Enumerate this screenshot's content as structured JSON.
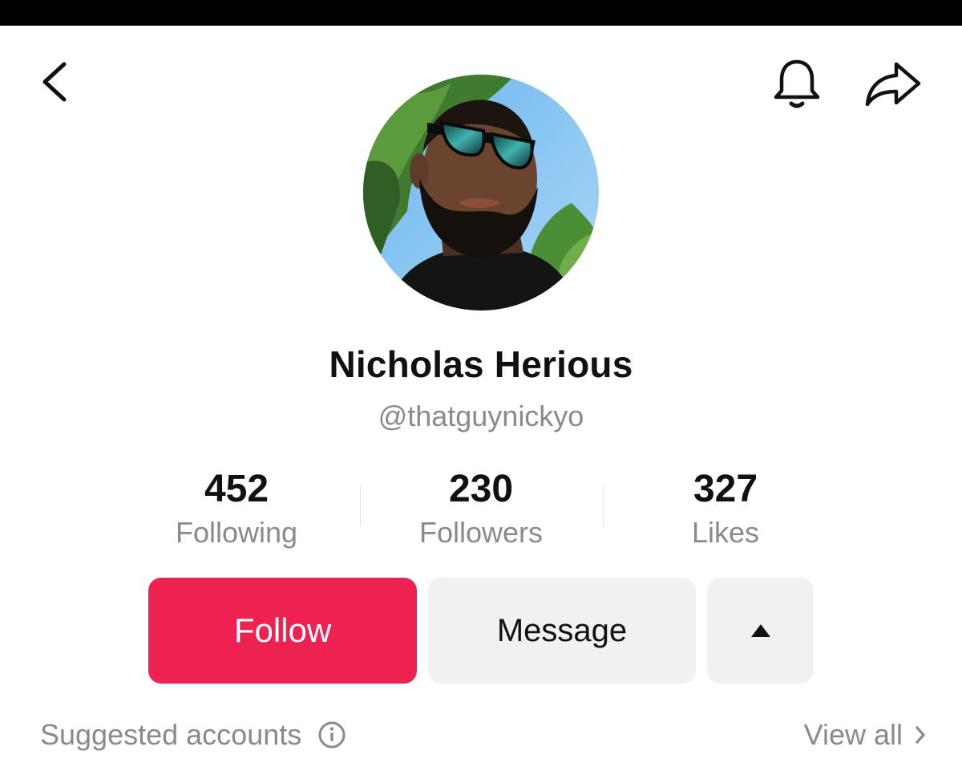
{
  "header": {
    "back_icon": "chevron-left-icon",
    "notifications_icon": "bell-icon",
    "share_icon": "share-arrow-icon"
  },
  "profile": {
    "avatar": "profile-photo",
    "display_name": "Nicholas Herious",
    "username": "@thatguynickyo"
  },
  "stats": [
    {
      "value": "452",
      "label": "Following"
    },
    {
      "value": "230",
      "label": "Followers"
    },
    {
      "value": "327",
      "label": "Likes"
    }
  ],
  "actions": {
    "follow_label": "Follow",
    "message_label": "Message",
    "more_icon": "triangle-up-icon"
  },
  "suggested": {
    "title": "Suggested accounts",
    "info_icon": "info-icon",
    "view_all_label": "View all"
  },
  "colors": {
    "accent": "#ee2251",
    "secondary_button": "#f1f1f1",
    "muted_text": "#8a8a8a"
  }
}
